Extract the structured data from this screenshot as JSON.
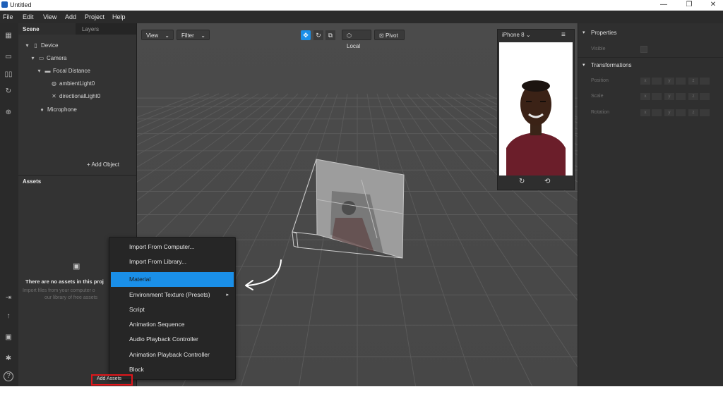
{
  "window": {
    "title": "Untitled",
    "controls": [
      "—",
      "❐",
      "✕"
    ]
  },
  "menubar": {
    "items": [
      "File",
      "Edit",
      "View",
      "Add",
      "Project",
      "Help"
    ]
  },
  "scene_panel": {
    "tabs": [
      "Scene",
      "Layers"
    ],
    "tree": [
      {
        "label": "Device",
        "icon": "device-icon"
      },
      {
        "label": "Camera",
        "icon": "camera-icon"
      },
      {
        "label": "Focal Distance",
        "icon": "focal-distance-icon"
      },
      {
        "label": "ambientLight0",
        "icon": "globe-light-icon"
      },
      {
        "label": "directionalLight0",
        "icon": "directional-light-icon"
      },
      {
        "label": "Microphone",
        "icon": "microphone-icon"
      }
    ],
    "add_object": "+ Add Object"
  },
  "assets_panel": {
    "title": "Assets",
    "empty_title": "There are no assets in this proj",
    "empty_hint_1": "Import files from your computer o",
    "empty_hint_2": "our library of free assets",
    "add_assets": "Add Assets"
  },
  "viewport": {
    "view_btn": "View",
    "filter_btn": "Filter",
    "local_btn": "Local",
    "pivot_btn": "Pivot",
    "device": "iPhone 8",
    "accent": "#1a8fe8"
  },
  "properties": {
    "title": "Properties",
    "visible_label": "Visible",
    "transformations_title": "Transformations",
    "rows": [
      {
        "label": "Position",
        "cells": [
          "x",
          "y",
          "z"
        ]
      },
      {
        "label": "Scale",
        "cells": [
          "x",
          "y",
          "z"
        ]
      },
      {
        "label": "Rotation",
        "cells": [
          "x",
          "y",
          "z"
        ]
      }
    ]
  },
  "context_menu": {
    "items": [
      "Import From Computer...",
      "Import From Library...",
      "Material",
      "Environment Texture (Presets)",
      "Script",
      "Animation Sequence",
      "Audio Playback Controller",
      "Animation Playback Controller",
      "Block"
    ],
    "selected": "Material",
    "submenu_marker": "▸"
  }
}
